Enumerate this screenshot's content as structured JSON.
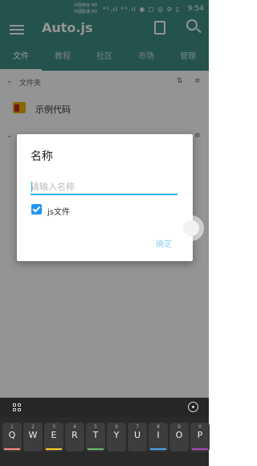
{
  "status_bar": {
    "carrier1": "中国电信 HD",
    "carrier2": "中国联通 HD",
    "icons": "⁴ᴳ.ıl ⁴ᴳ.ıl ◉ ◻ ◎ ⊘ ▯",
    "time": "9:54"
  },
  "appbar": {
    "title": "Auto.js",
    "menu_icon": "menu-icon",
    "clipboard_icon": "clipboard-icon",
    "search_icon": "search-icon"
  },
  "tabs": [
    "文件",
    "教程",
    "社区",
    "市场",
    "管理"
  ],
  "sections": {
    "folders_label": "文件夹",
    "example_folder": "示例代码"
  },
  "dialog": {
    "title": "名称",
    "input_placeholder": "请输入名称",
    "checkbox_label": "js文件",
    "checkbox_checked": true,
    "confirm_label": "确定"
  },
  "keyboard": {
    "keys": [
      {
        "letter": "Q",
        "sub": "1"
      },
      {
        "letter": "W",
        "sub": "2"
      },
      {
        "letter": "E",
        "sub": "3"
      },
      {
        "letter": "R",
        "sub": "4"
      },
      {
        "letter": "T",
        "sub": "5"
      },
      {
        "letter": "Y",
        "sub": "6"
      },
      {
        "letter": "U",
        "sub": "7"
      },
      {
        "letter": "I",
        "sub": "8"
      },
      {
        "letter": "O",
        "sub": "9"
      },
      {
        "letter": "P",
        "sub": "0"
      }
    ]
  },
  "colors": {
    "appbar": "#3f8f86",
    "accent": "#29b6f6",
    "checkbox": "#2196f3",
    "confirm_text": "#8fd3f4"
  }
}
